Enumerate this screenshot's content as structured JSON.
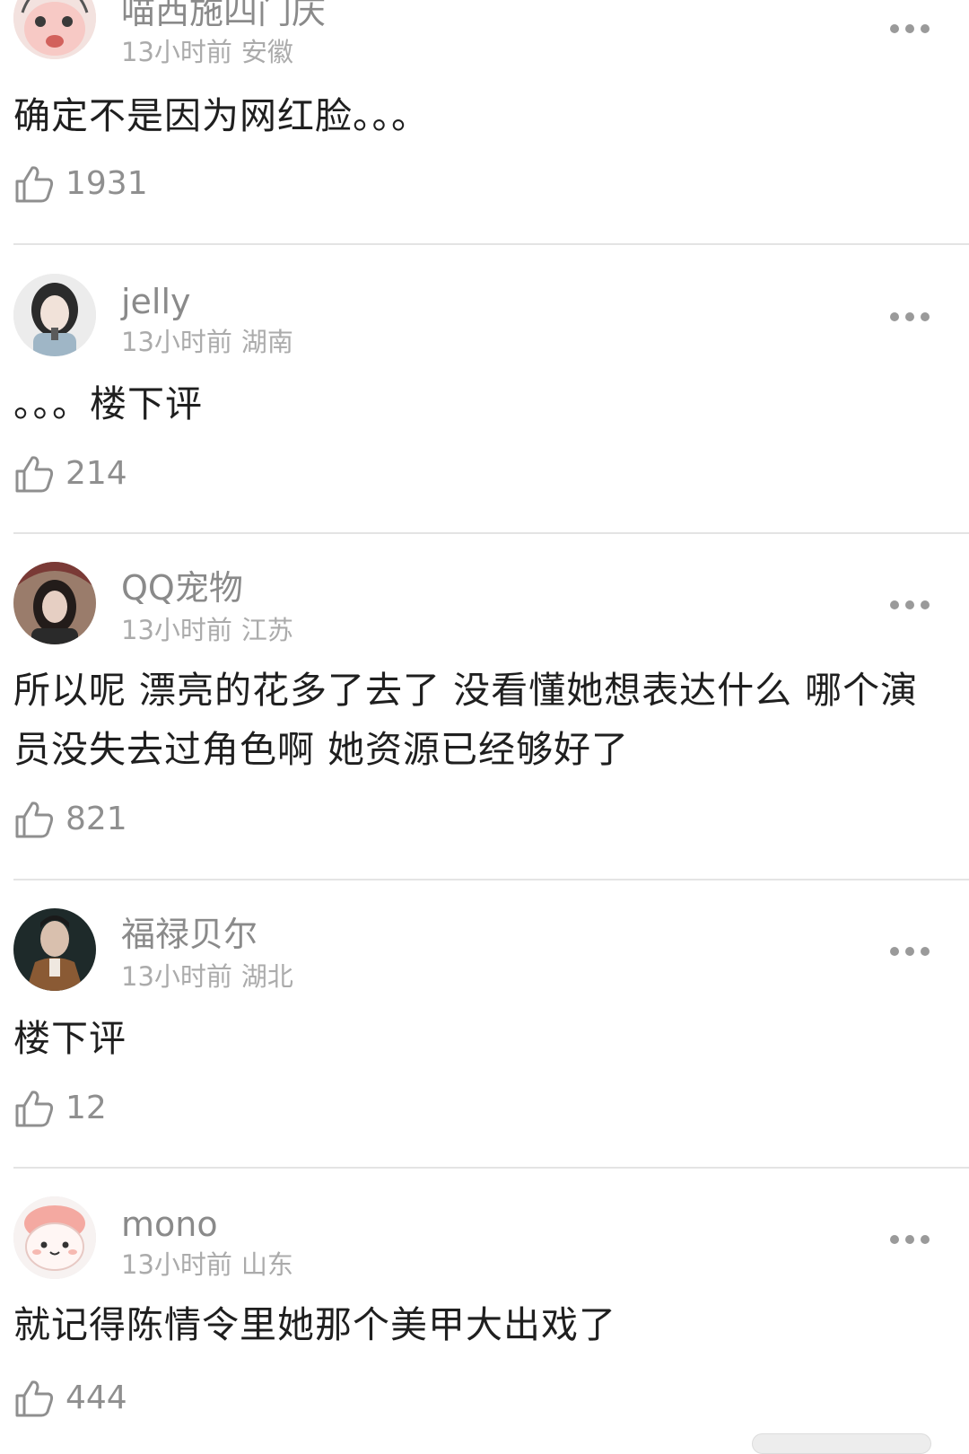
{
  "comments": [
    {
      "username": "喵西施四门庆",
      "time": "13小时前",
      "region": "安徽",
      "content": "确定不是因为网红脸。。。",
      "likes": "1931",
      "avatar_icon": "cartoon-avatar-icon"
    },
    {
      "username": "jelly",
      "time": "13小时前",
      "region": "湖南",
      "content": "。。。楼下评",
      "likes": "214",
      "avatar_icon": "photo-avatar-icon"
    },
    {
      "username": "QQ宠物",
      "time": "13小时前",
      "region": "江苏",
      "content": "所以呢 漂亮的花多了去了 没看懂她想表达什么 哪个演员没失去过角色啊 她资源已经够好了",
      "likes": "821",
      "avatar_icon": "photo-avatar-icon"
    },
    {
      "username": "福禄贝尔",
      "time": "13小时前",
      "region": "湖北",
      "content": "楼下评",
      "likes": "12",
      "avatar_icon": "photo-avatar-icon"
    },
    {
      "username": "mono",
      "time": "13小时前",
      "region": "山东",
      "content": "就记得陈情令里她那个美甲大出戏了",
      "likes": "444",
      "avatar_icon": "cartoon-avatar-icon"
    }
  ],
  "colors": {
    "username": "#8a8a8a",
    "meta": "#ababab",
    "content": "#1f1f1f",
    "divider": "#e4e4e4",
    "icon": "#9a9a9a"
  }
}
